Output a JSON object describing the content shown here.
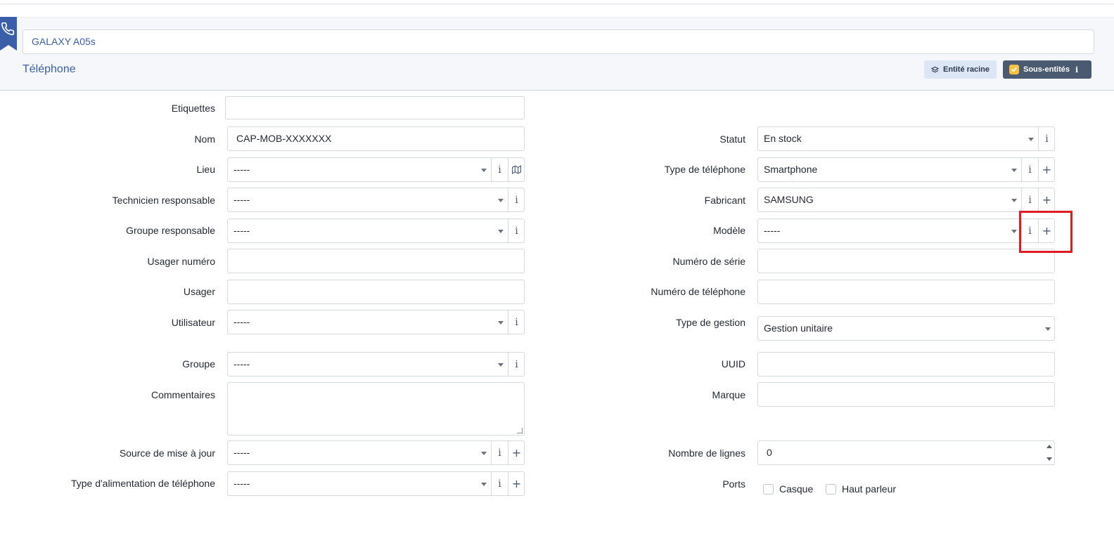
{
  "header": {
    "item_name": "GALAXY A05s",
    "item_type": "Téléphone",
    "root_entity_button": "Entité racine",
    "sub_entities_button": "Sous-entités",
    "sub_entities_info": "i",
    "icon": "phone-icon"
  },
  "form_left": {
    "etiquettes_label": "Etiquettes",
    "etiquettes_value": "",
    "nom_label": "Nom",
    "nom_value": "CAP-MOB-XXXXXXX",
    "lieu_label": "Lieu",
    "lieu_value": "-----",
    "technicien_label": "Technicien responsable",
    "technicien_value": "-----",
    "groupe_resp_label": "Groupe responsable",
    "groupe_resp_value": "-----",
    "usager_numero_label": "Usager numéro",
    "usager_numero_value": "",
    "usager_label": "Usager",
    "usager_value": "",
    "utilisateur_label": "Utilisateur",
    "utilisateur_value": "-----",
    "groupe_label": "Groupe",
    "groupe_value": "-----",
    "commentaires_label": "Commentaires",
    "commentaires_value": "",
    "source_label": "Source de mise à jour",
    "source_value": "-----",
    "alimentation_label": "Type d'alimentation de téléphone",
    "alimentation_value": "-----"
  },
  "form_right": {
    "statut_label": "Statut",
    "statut_value": "En stock",
    "type_tel_label": "Type de téléphone",
    "type_tel_value": "Smartphone",
    "fabricant_label": "Fabricant",
    "fabricant_value": "SAMSUNG",
    "modele_label": "Modèle",
    "modele_value": "-----",
    "serie_label": "Numéro de série",
    "serie_value": "",
    "numero_tel_label": "Numéro de téléphone",
    "numero_tel_value": "",
    "gestion_label": "Type de gestion",
    "gestion_value": "Gestion unitaire",
    "uuid_label": "UUID",
    "uuid_value": "",
    "marque_label": "Marque",
    "marque_value": "",
    "lignes_label": "Nombre de lignes",
    "lignes_value": "0",
    "ports_label": "Ports",
    "casque_label": "Casque",
    "haut_parleur_label": "Haut parleur"
  },
  "glyphs": {
    "info": "i",
    "plus": "+"
  },
  "colors": {
    "accent": "#3a5fa8",
    "highlight": "#e01b24",
    "sub_entities_bg": "#4a5a71",
    "checkbox_checked": "#f6c244"
  }
}
